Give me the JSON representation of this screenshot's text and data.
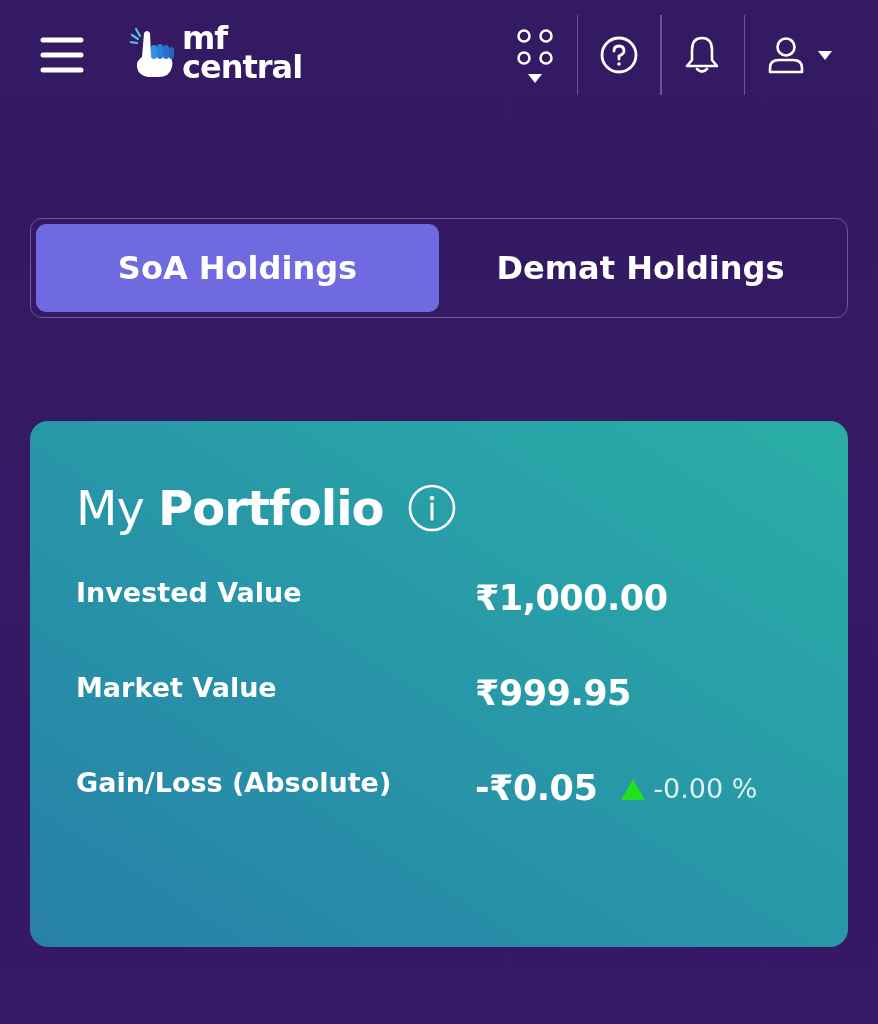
{
  "header": {
    "logo": {
      "line_1": "mf",
      "line_2": "central"
    }
  },
  "tabs": [
    {
      "label": "SoA Holdings",
      "selected": true
    },
    {
      "label": "Demat Holdings",
      "selected": false
    }
  ],
  "portfolio": {
    "title": "My **Portfolio**",
    "rows": [
      {
        "label": "Invested Value",
        "value": "₹1,000.00"
      },
      {
        "label": "Market Value",
        "value": "₹999.95"
      },
      {
        "label": "Gain/Loss (Absolute)",
        "value": "-₹0.05",
        "change": {
          "rising": true,
          "text": "-0.00 %"
        }
      }
    ]
  }
}
